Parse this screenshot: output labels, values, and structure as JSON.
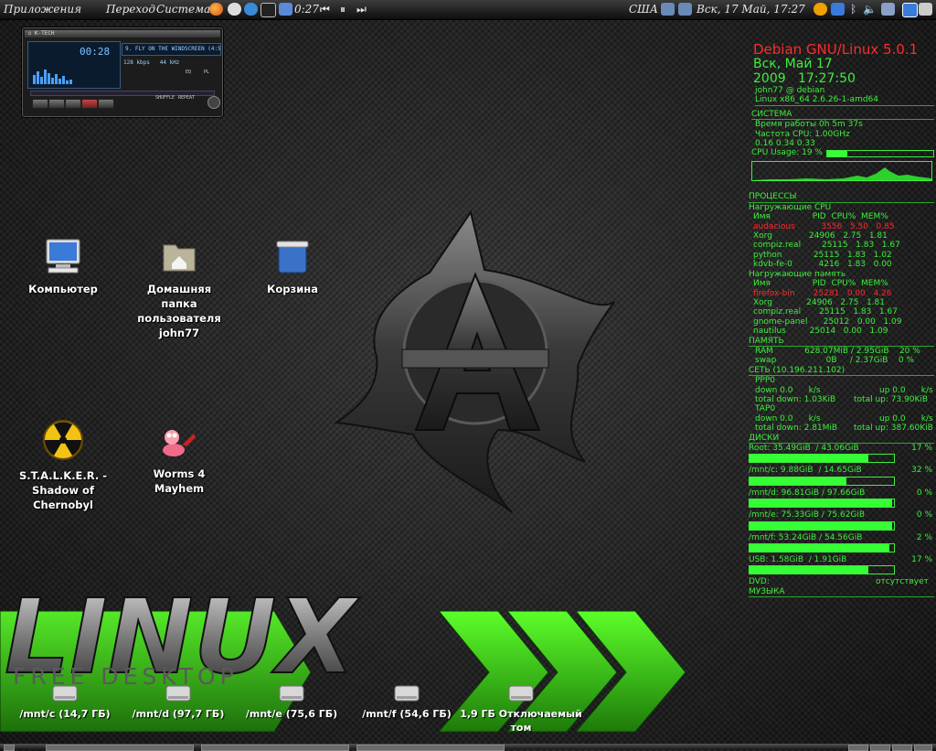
{
  "panel": {
    "menus": [
      "Приложения",
      "Переход",
      "Система"
    ],
    "time_elapsed": "0:27",
    "media_controls": [
      "prev-icon",
      "pause-icon",
      "next-icon"
    ],
    "keyboard_layout": "США",
    "datetime": "Вск, 17 Май, 17:27"
  },
  "xmms": {
    "title": "K-TECH",
    "time": "00:28",
    "song": "9. FLY ON THE WINDSCREEN (4:59)",
    "bitrate": "128 kbps",
    "samplerate": "44 kHz",
    "eq_label": "EQ",
    "pl_label": "PL",
    "shuffle": "SHUFFLE",
    "repeat": "REPEAT"
  },
  "desktop_icons": [
    {
      "label": "Компьютер",
      "icon": "computer-icon"
    },
    {
      "label": "Домашняя папка пользователя john77",
      "icon": "home-folder-icon"
    },
    {
      "label": "Корзина",
      "icon": "trash-icon"
    },
    {
      "label": "S.T.A.L.K.E.R. - Shadow of Chernobyl",
      "icon": "radiation-icon"
    },
    {
      "label": "Worms 4 Mayhem",
      "icon": "worm-icon"
    }
  ],
  "wallpaper": {
    "word": "LINUX",
    "tagline": "FREE DESKTOP",
    "accent": "#3ecf1a"
  },
  "conky": {
    "title": "Debian GNU/Linux 5.0.1",
    "date": "Вск, Май 17 2009",
    "time": "17:27:50",
    "user_host": "john77 @ debian",
    "kernel": "Linux x86_64 2.6.26-1-amd64",
    "system": {
      "header": "СИСТЕМА",
      "uptime": "Время работы 0h 5m 37s",
      "cpu_freq": "Частота CPU: 1.00GHz",
      "loadavg": "0.16 0.34 0.33",
      "cpu_usage_label": "CPU Usage: 19 %",
      "cpu_usage": 0.19
    },
    "processes": {
      "header": "ПРОЦЕССЫ",
      "cpu_header": "Нагружающие CPU",
      "columns": "Имя                PID  CPU%  MEM%",
      "cpu_rows": [
        {
          "text": "audacious          3556   5.50   0.85",
          "hot": true
        },
        {
          "text": "Xorg              24906   2.75   1.81",
          "hot": false
        },
        {
          "text": "compiz.real        25115   1.83   1.67",
          "hot": false
        },
        {
          "text": "python            25115   1.83   1.02",
          "hot": false
        },
        {
          "text": "kdvb-fe-0          4216   1.83   0.00",
          "hot": false
        }
      ],
      "mem_header": "Нагружающие память",
      "mem_rows": [
        {
          "text": "firefox-bin       25281   0.00   4.26",
          "hot": true
        },
        {
          "text": "Xorg             24906   2.75   1.81",
          "hot": false
        },
        {
          "text": "compiz.real       25115   1.83   1.67",
          "hot": false
        },
        {
          "text": "gnome-panel      25012   0.00   1.09",
          "hot": false
        },
        {
          "text": "nautilus         25014   0.00   1.09",
          "hot": false
        }
      ]
    },
    "memory": {
      "header": "ПАМЯТЬ",
      "ram": "RAM            628.07MiB / 2.95GiB    20 %",
      "swap": "swap                   0B     / 2.37GiB    0 %"
    },
    "network": {
      "header": "СЕТЬ (10.196.211.102)",
      "ppp0": "PPP0",
      "ppp0_down": "down 0.0      k/s",
      "ppp0_up": "up 0.0      k/s",
      "ppp0_total_down": "total down: 1.03KiB",
      "ppp0_total_up": "total up: 73.90KiB",
      "tap0": "TAP0",
      "tap0_down": "down 0.0      k/s",
      "tap0_up": "up 0.0      k/s",
      "tap0_total_down": "total down: 2.81MiB",
      "tap0_total_up": "total up: 387.60KiB"
    },
    "disks": {
      "header": "ДИСКИ",
      "items": [
        {
          "label": "Root: 35.49GiB  / 43.06GiB",
          "pct_label": "17 %",
          "used": 0.82
        },
        {
          "label": "/mnt/c: 9.88GiB  / 14.65GiB",
          "pct_label": "32 %",
          "used": 0.67
        },
        {
          "label": "/mnt/d: 96.81GiB / 97.66GiB",
          "pct_label": "0 %",
          "used": 0.99
        },
        {
          "label": "/mnt/e: 75.33GiB / 75.62GiB",
          "pct_label": "0 %",
          "used": 0.99
        },
        {
          "label": "/mnt/f: 53.24GiB / 54.56GiB",
          "pct_label": "2 %",
          "used": 0.97
        },
        {
          "label": "USB: 1.58GiB  / 1.91GiB",
          "pct_label": "17 %",
          "used": 0.82
        }
      ],
      "dvd_label": "DVD:",
      "dvd_status": "отсутствует"
    },
    "music_header": "МУЗЫКА"
  },
  "drives": [
    {
      "label": "/mnt/c (14,7 ГБ)"
    },
    {
      "label": "/mnt/d (97,7 ГБ)"
    },
    {
      "label": "/mnt/e (75,6 ГБ)"
    },
    {
      "label": "/mnt/f (54,6 ГБ)"
    },
    {
      "label": "1,9 ГБ Отключаемый том"
    }
  ]
}
